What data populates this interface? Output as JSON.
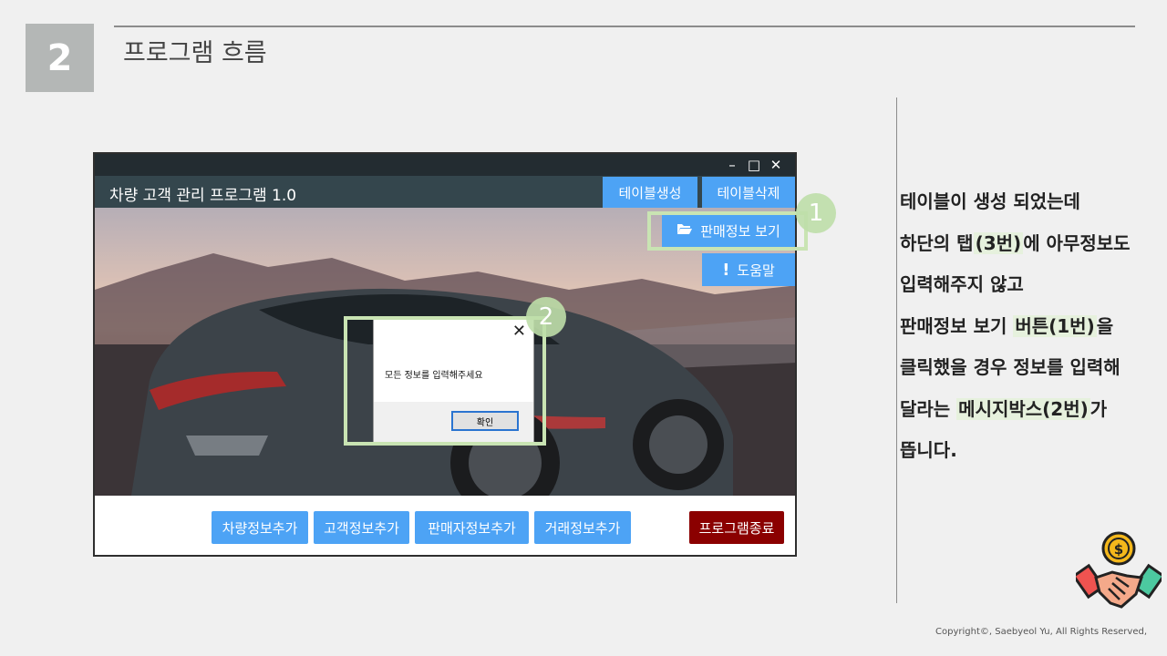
{
  "slide": {
    "number": "2",
    "title": "프로그램 흐름"
  },
  "app": {
    "title": "차량 고객 관리 프로그램 1.0",
    "window_controls": {
      "minimize": "–",
      "maximize": "□",
      "close": "✕"
    },
    "header_buttons": {
      "create_table": "테이블생성",
      "delete_table": "테이블삭제"
    },
    "side_buttons": {
      "view_sales": "판매정보 보기",
      "help": "도움말"
    },
    "footer_buttons": {
      "add_vehicle": "차량정보추가",
      "add_customer": "고객정보추가",
      "add_seller": "판매자정보추가",
      "add_transaction": "거래정보추가",
      "exit": "프로그램종료"
    },
    "messagebox": {
      "text": "모든 정보를 입력해주세요",
      "ok": "확인",
      "close": "✕"
    }
  },
  "markers": {
    "one": "1",
    "two": "2"
  },
  "description": {
    "line1": "테이블이 생성 되었는데",
    "line2_pre": "하단의 탭",
    "line2_hl": "(3번)",
    "line2_post": "에 아무정보도",
    "line3": "입력해주지 않고",
    "line4_pre": "판매정보 보기 ",
    "line4_hl": "버튼(1번)",
    "line4_post": "을",
    "line5": "클릭했을 경우 정보를 입력해",
    "line6_pre": "달라는 ",
    "line6_hl": "메시지박스(2번)",
    "line6_post": "가",
    "line7": "뜹니다."
  },
  "copyright": "Copyright©, Saebyeol Yu, All Rights Reserved,",
  "colors": {
    "accent_blue": "#4da3f5",
    "exit_red": "#8b0000",
    "highlight_green": "#c9e4b3"
  }
}
